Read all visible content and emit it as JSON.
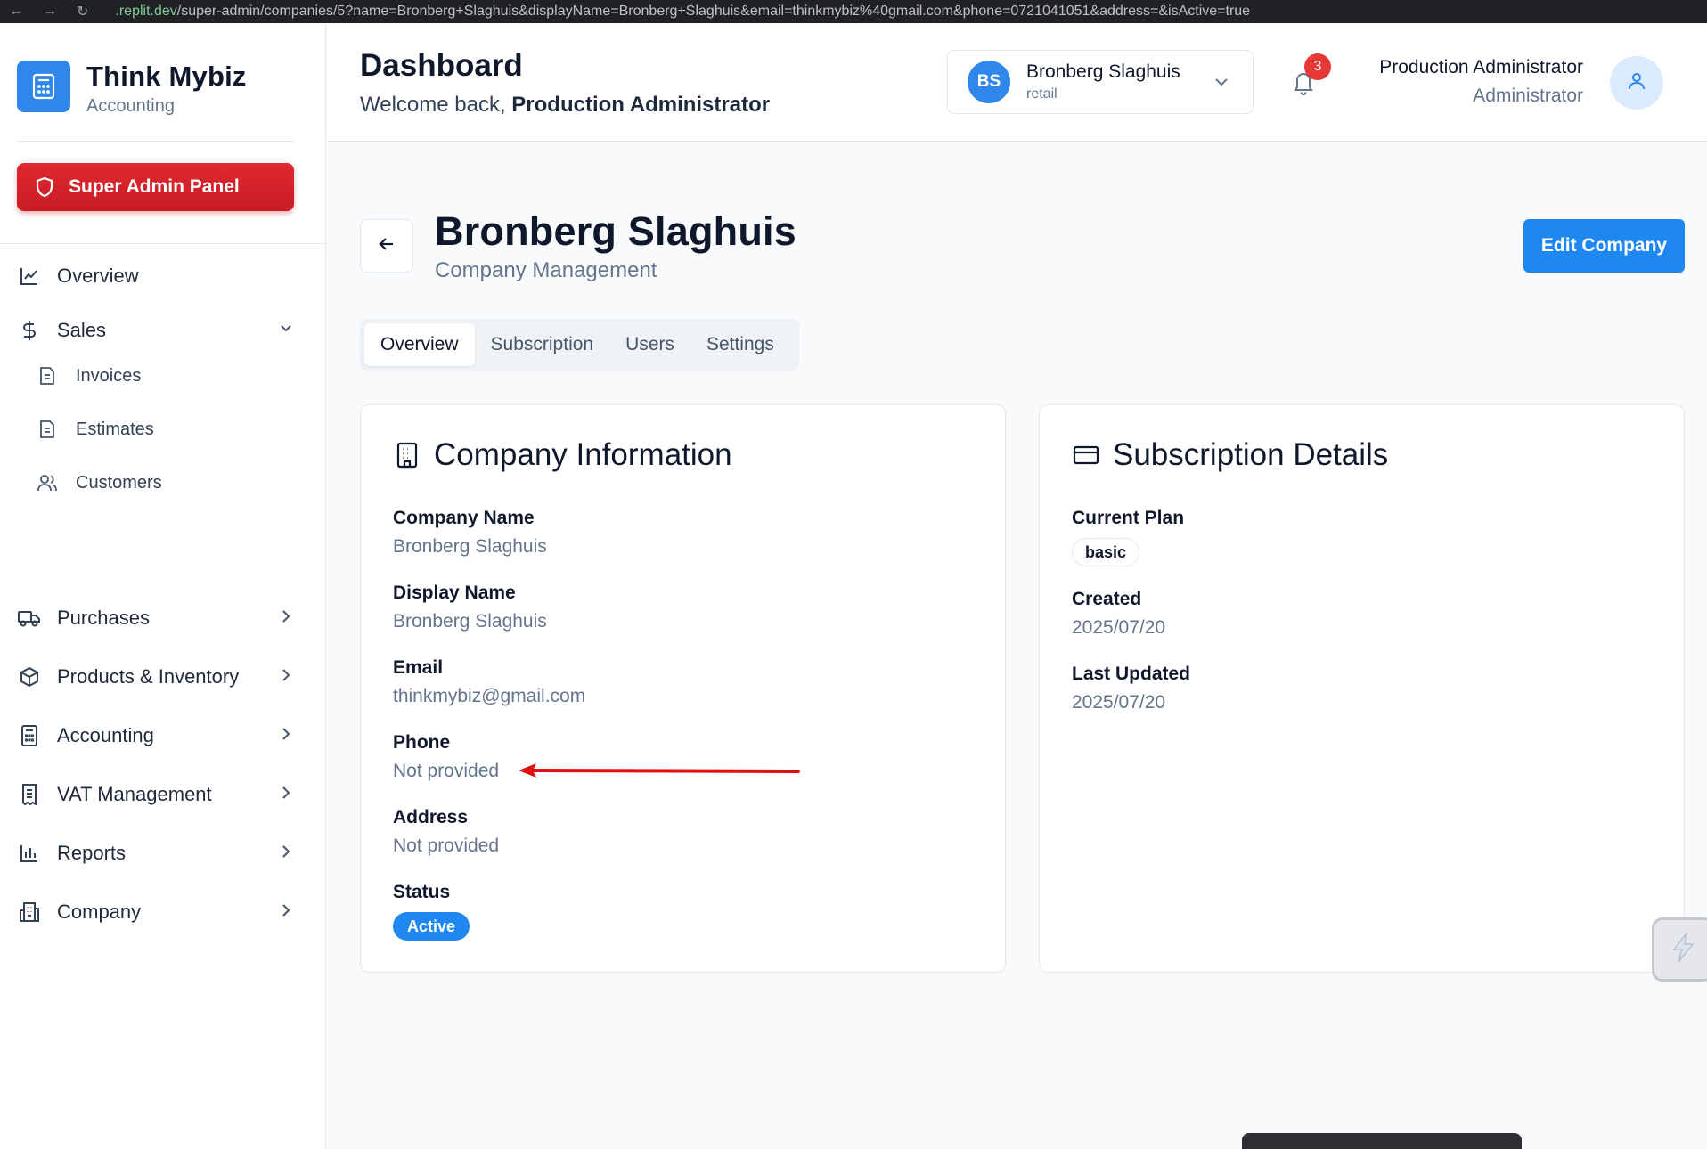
{
  "browser": {
    "url_host": ".replit.dev",
    "url_rest": "/super-admin/companies/5?name=Bronberg+Slaghuis&displayName=Bronberg+Slaghuis&email=thinkmybiz%40gmail.com&phone=0721041051&address=&isActive=true"
  },
  "brand": {
    "name": "Think Mybiz",
    "subtitle": "Accounting"
  },
  "admin_button": {
    "label": "Super Admin Panel"
  },
  "sidebar": {
    "items": [
      {
        "label": "Overview",
        "icon": "line-chart-icon"
      },
      {
        "label": "Sales",
        "icon": "dollar-icon",
        "expanded": true
      },
      {
        "label": "Invoices",
        "icon": "document-icon"
      },
      {
        "label": "Estimates",
        "icon": "document-icon"
      },
      {
        "label": "Customers",
        "icon": "users-icon"
      },
      {
        "label": "Purchases",
        "icon": "truck-icon"
      },
      {
        "label": "Products & Inventory",
        "icon": "box-icon"
      },
      {
        "label": "Accounting",
        "icon": "calculator-icon"
      },
      {
        "label": "VAT Management",
        "icon": "receipt-icon"
      },
      {
        "label": "Reports",
        "icon": "bar-chart-icon"
      },
      {
        "label": "Company",
        "icon": "building-icon"
      }
    ]
  },
  "header": {
    "title": "Dashboard",
    "welcome_prefix": "Welcome back, ",
    "welcome_name": "Production Administrator",
    "company_switch": {
      "initials": "BS",
      "name": "Bronberg Slaghuis",
      "type": "retail"
    },
    "notifications_count": "3",
    "user_name": "Production Administrator",
    "user_role": "Administrator"
  },
  "page": {
    "title": "Bronberg Slaghuis",
    "subtitle": "Company Management",
    "edit_button": "Edit Company",
    "tabs": [
      "Overview",
      "Subscription",
      "Users",
      "Settings"
    ],
    "active_tab": "Overview"
  },
  "company_info": {
    "title": "Company Information",
    "fields": [
      {
        "label": "Company Name",
        "value": "Bronberg Slaghuis"
      },
      {
        "label": "Display Name",
        "value": "Bronberg Slaghuis"
      },
      {
        "label": "Email",
        "value": "thinkmybiz@gmail.com"
      },
      {
        "label": "Phone",
        "value": "Not provided"
      },
      {
        "label": "Address",
        "value": "Not provided"
      }
    ],
    "status_label": "Status",
    "status_value": "Active"
  },
  "subscription": {
    "title": "Subscription Details",
    "plan_label": "Current Plan",
    "plan_value": "basic",
    "created_label": "Created",
    "created_value": "2025/07/20",
    "updated_label": "Last Updated",
    "updated_value": "2025/07/20"
  },
  "colors": {
    "primary": "#1e88f0",
    "danger": "#d22229",
    "annotation": "#e01010"
  }
}
